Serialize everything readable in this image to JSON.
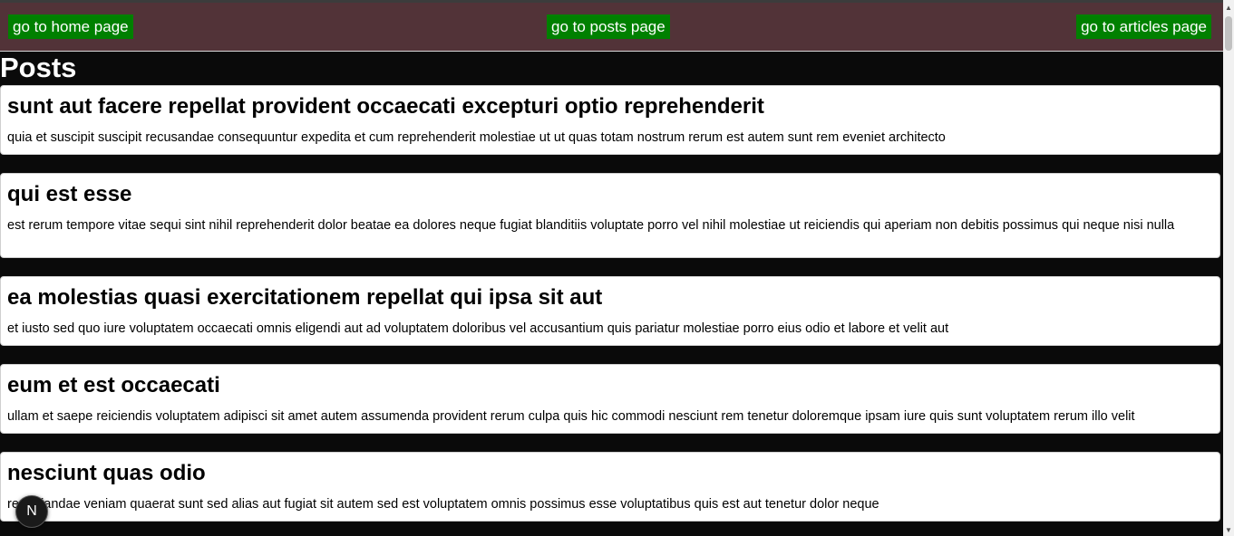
{
  "nav": {
    "home_label": "go to home page",
    "posts_label": "go to posts page",
    "articles_label": "go to articles page"
  },
  "page": {
    "title": "Posts"
  },
  "posts": [
    {
      "title": "sunt aut facere repellat provident occaecati excepturi optio reprehenderit",
      "body": "quia et suscipit suscipit recusandae consequuntur expedita et cum reprehenderit molestiae ut ut quas totam nostrum rerum est autem sunt rem eveniet architecto"
    },
    {
      "title": "qui est esse",
      "body": "est rerum tempore vitae sequi sint nihil reprehenderit dolor beatae ea dolores neque fugiat blanditiis voluptate porro vel nihil molestiae ut reiciendis qui aperiam non debitis possimus qui neque nisi nulla"
    },
    {
      "title": "ea molestias quasi exercitationem repellat qui ipsa sit aut",
      "body": "et iusto sed quo iure voluptatem occaecati omnis eligendi aut ad voluptatem doloribus vel accusantium quis pariatur molestiae porro eius odio et labore et velit aut"
    },
    {
      "title": "eum et est occaecati",
      "body": "ullam et saepe reiciendis voluptatem adipisci sit amet autem assumenda provident rerum culpa quis hic commodi nesciunt rem tenetur doloremque ipsam iure quis sunt voluptatem rerum illo velit"
    },
    {
      "title": "nesciunt quas odio",
      "body": "repudiandae veniam quaerat sunt sed alias aut fugiat sit autem sed est voluptatem omnis possimus esse voluptatibus quis est aut tenetur dolor neque"
    }
  ],
  "badge": {
    "letter": "N",
    "icon": "nextjs-logo-icon"
  },
  "colors": {
    "nav_bar": "#523338",
    "nav_button": "#008000",
    "page_background": "#0a0a0a",
    "card_background": "#ffffff"
  }
}
